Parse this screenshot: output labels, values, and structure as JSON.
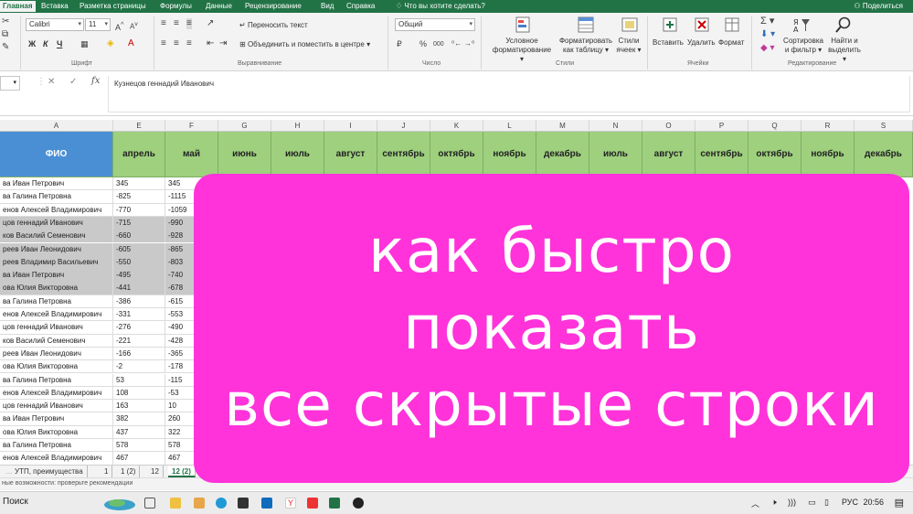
{
  "ribbon_tabs": [
    "Главная",
    "Вставка",
    "Разметка страницы",
    "Формулы",
    "Данные",
    "Рецензирование",
    "Вид",
    "Справка"
  ],
  "tell_me": "Что вы хотите сделать?",
  "share": "Поделиться",
  "ribbon": {
    "font_name": "Calibri",
    "font_size": "11",
    "bold": "Ж",
    "italic": "К",
    "underline": "Ч",
    "wrap_text": "Переносить текст",
    "merge_center": "Объединить и поместить в центре",
    "number_format": "Общий",
    "currency": "₽",
    "percent": "%",
    "thousands": "000",
    "conditional_format": [
      "Условное",
      "форматирование"
    ],
    "format_table": [
      "Форматировать",
      "как таблицу"
    ],
    "cell_styles": [
      "Стили",
      "ячеек"
    ],
    "insert": "Вставить",
    "delete": "Удалить",
    "format": "Формат",
    "sort_filter": [
      "Сортировка",
      "и фильтр"
    ],
    "find_select": [
      "Найти и",
      "выделить"
    ],
    "groups": {
      "font": "Шрифт",
      "alignment": "Выравнивание",
      "number": "Число",
      "styles": "Стили",
      "cells": "Ячейки",
      "editing": "Редактирование"
    }
  },
  "formula_bar": {
    "cancel": "✕",
    "enter": "✓",
    "fx": "fx",
    "content": "Кузнецов геннадий Иванович"
  },
  "columns": [
    "A",
    "E",
    "F",
    "G",
    "H",
    "I",
    "J",
    "K",
    "L",
    "M",
    "N",
    "O",
    "P",
    "Q",
    "R",
    "S"
  ],
  "header_row": [
    "ФИО",
    "апрель",
    "май",
    "июнь",
    "июль",
    "август",
    "сентябрь",
    "октябрь",
    "ноябрь",
    "декабрь",
    "июль",
    "август",
    "сентябрь",
    "октябрь",
    "ноябрь",
    "декабрь"
  ],
  "rows": [
    {
      "name": "ва Иван Петрович",
      "e": "345",
      "f": "345"
    },
    {
      "name": "ва Галина Петровна",
      "e": "-825",
      "f": "-1115"
    },
    {
      "name": "енов Алексей Владимирович",
      "e": "-770",
      "f": "-1059"
    },
    {
      "name": "цов геннадий Иванович",
      "e": "-715",
      "f": "-990"
    },
    {
      "name": "ков Василий Семенович",
      "e": "-660",
      "f": "-928"
    },
    {
      "name": "реев Иван Леонидович",
      "e": "-605",
      "f": "-865"
    },
    {
      "name": "реев Владимир Васильевич",
      "e": "-550",
      "f": "-803"
    },
    {
      "name": "ва Иван Петрович",
      "e": "-495",
      "f": "-740"
    },
    {
      "name": "ова Юлия Викторовна",
      "e": "-441",
      "f": "-678"
    },
    {
      "name": "ва Галина Петровна",
      "e": "-386",
      "f": "-615"
    },
    {
      "name": "енов Алексей Владимирович",
      "e": "-331",
      "f": "-553"
    },
    {
      "name": "цов геннадий Иванович",
      "e": "-276",
      "f": "-490"
    },
    {
      "name": "ков Василий Семенович",
      "e": "-221",
      "f": "-428"
    },
    {
      "name": "реев Иван Леонидович",
      "e": "-166",
      "f": "-365"
    },
    {
      "name": "ова Юлия Викторовна",
      "e": "-2",
      "f": "-178"
    },
    {
      "name": "ва Галина Петровна",
      "e": "53",
      "f": "-115"
    },
    {
      "name": "енов Алексей Владимирович",
      "e": "108",
      "f": "-53"
    },
    {
      "name": "цов геннадий Иванович",
      "e": "163",
      "f": "10"
    },
    {
      "name": "ва Иван Петрович",
      "e": "382",
      "f": "260"
    },
    {
      "name": "ова Юлия Викторовна",
      "e": "437",
      "f": "322"
    },
    {
      "name": "ва Галина Петровна",
      "e": "578",
      "f": "578"
    },
    {
      "name": "енов Алексей Владимирович",
      "e": "467",
      "f": "467"
    }
  ],
  "sheet_tabs": [
    "УТП, преимущества",
    "1",
    "1 (2)",
    "12",
    "12 (2)"
  ],
  "status_text": "ные возможности: проверьте рекомендации",
  "taskbar": {
    "search": "Поиск",
    "lang": "РУС",
    "time": "20:56"
  },
  "banner": {
    "line1": "как быстро",
    "line2": "показать",
    "line3": "все скрытые строки"
  },
  "colors": {
    "excel_green": "#217346",
    "header_green": "#9ed07e",
    "header_blue": "#4a8fd4",
    "banner_pink": "#ff33d9",
    "hidden_row_grey": "#c9c9c9"
  }
}
